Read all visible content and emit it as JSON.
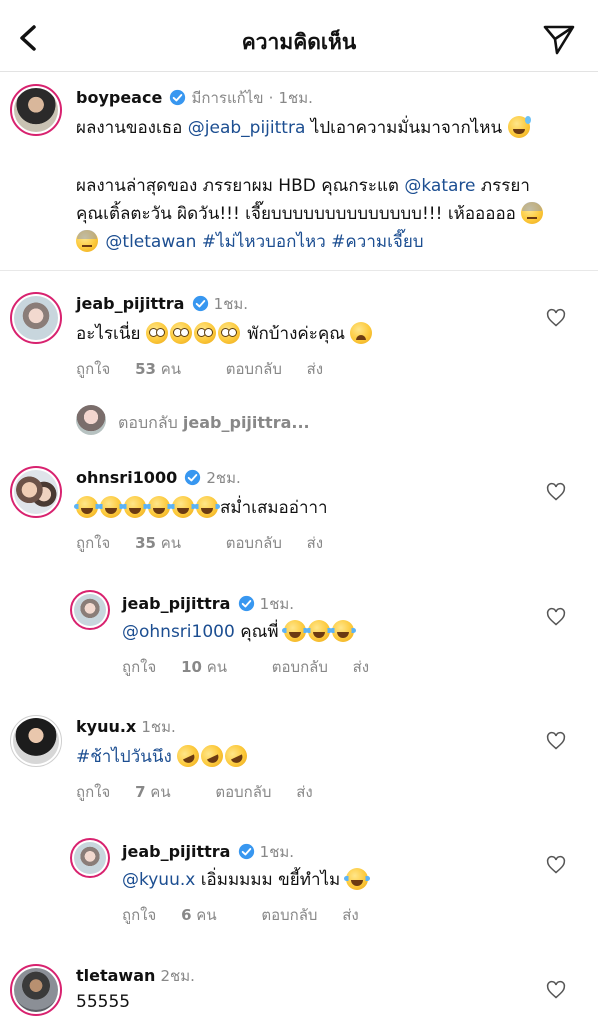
{
  "header": {
    "title": "ความคิดเห็น"
  },
  "caption": {
    "username": "boypeace",
    "edited": "มีการแก้ไข",
    "time": "1ชม.",
    "line1_a": "ผลงานของเธอ ",
    "line1_mention": "@jeab_pijittra",
    "line1_b": " ไปเอาความมั่นมาจากไหน",
    "line2_a": "ผลงานล่าสุดของ ภรรยาผม HBD คุณกระแต ",
    "line2_mention": "@katare",
    "line2_b": " ภรรยา",
    "line3": "คุณเติ้ลตะวัน ผิดวัน!!! เจี๊ยบบบบบบบบบบบบบบ!!! เห้อออออ",
    "line4_mention": "@tletawan",
    "line4_tag1": "#ไม่ไหวบอกไหว",
    "line4_tag2": "#ความเจี๊ยบ"
  },
  "comments": [
    {
      "username": "jeab_pijittra",
      "time": "1ชม.",
      "text": "อะไรเนี่ย",
      "text_after": "พักบ้างค่ะคุณ",
      "likes_label": "ถูกใจ",
      "likes": "53",
      "likes_unit": "คน",
      "reply": "ตอบกลับ",
      "send": "ส่ง"
    },
    {
      "username": "ohnsri1000",
      "time": "2ชม.",
      "text": "สม่ำเสมออ่าาา",
      "likes_label": "ถูกใจ",
      "likes": "35",
      "likes_unit": "คน",
      "reply": "ตอบกลับ",
      "send": "ส่ง"
    },
    {
      "username": "jeab_pijittra",
      "time": "1ชม.",
      "mention": "@ohnsri1000",
      "text": " คุณพี่",
      "likes_label": "ถูกใจ",
      "likes": "10",
      "likes_unit": "คน",
      "reply": "ตอบกลับ",
      "send": "ส่ง"
    },
    {
      "username": "kyuu.x",
      "time": "1ชม.",
      "hashtag": "#ช้าไปวันนึง",
      "likes_label": "ถูกใจ",
      "likes": "7",
      "likes_unit": "คน",
      "reply": "ตอบกลับ",
      "send": "ส่ง"
    },
    {
      "username": "jeab_pijittra",
      "time": "1ชม.",
      "mention": "@kyuu.x",
      "text": " เอิ่มมมมม ขยี้ทำไม",
      "likes_label": "ถูกใจ",
      "likes": "6",
      "likes_unit": "คน",
      "reply": "ตอบกลับ",
      "send": "ส่ง"
    },
    {
      "username": "tletawan",
      "time": "2ชม.",
      "text": "55555"
    }
  ],
  "view_replies": {
    "label": "ตอบกลับ",
    "username": "jeab_pijittra..."
  },
  "colors": {
    "link": "#1c4e91",
    "verified": "#3897f0",
    "story_ring": "#d8226f",
    "muted": "#888888"
  }
}
